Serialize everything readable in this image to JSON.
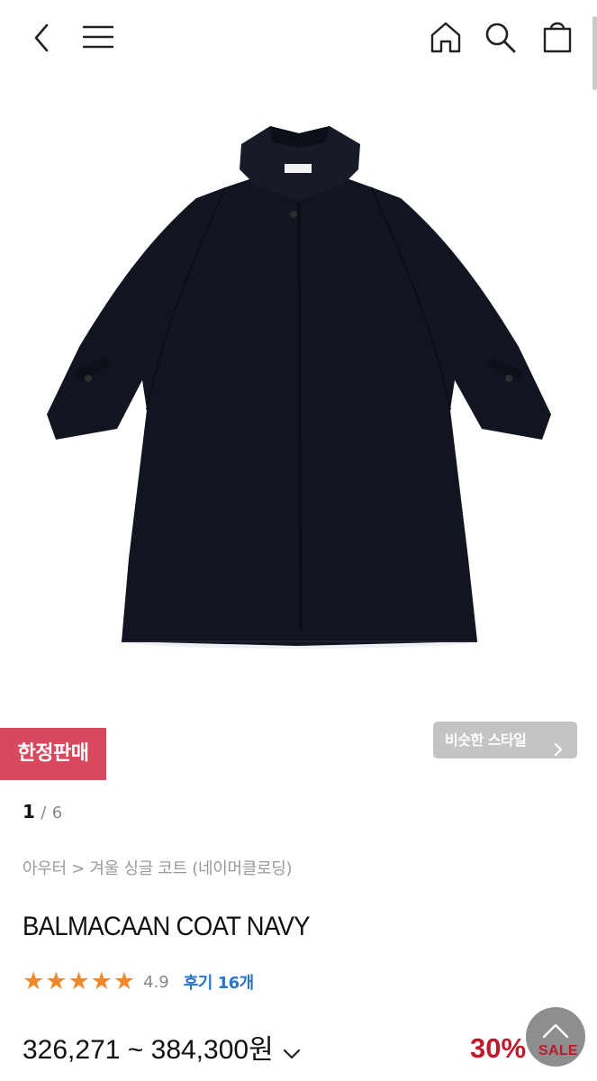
{
  "header": {
    "icons": [
      "back-arrow-icon",
      "menu-icon",
      "home-icon",
      "search-icon",
      "shopping-bag-icon"
    ]
  },
  "badges": {
    "limited": "한정판매"
  },
  "similar": {
    "label": "비슷한 스타일"
  },
  "pager": {
    "current": "1",
    "separator": "/",
    "total": "6"
  },
  "breadcrumb": "아우터 > 겨울 싱글 코트 (네이머클로딩)",
  "product": {
    "title": "BALMACAAN COAT NAVY",
    "rating": "4.9",
    "rating_stars": 5,
    "reviews": "후기 16개",
    "price": "326,271 ~ 384,300원",
    "discount": "30%",
    "sale": "SALE"
  },
  "colors": {
    "accent_badge": "#d8495d",
    "star": "#f0882c",
    "review_link": "#2a74c9",
    "discount": "#c0192b",
    "coat": "#11151f"
  }
}
